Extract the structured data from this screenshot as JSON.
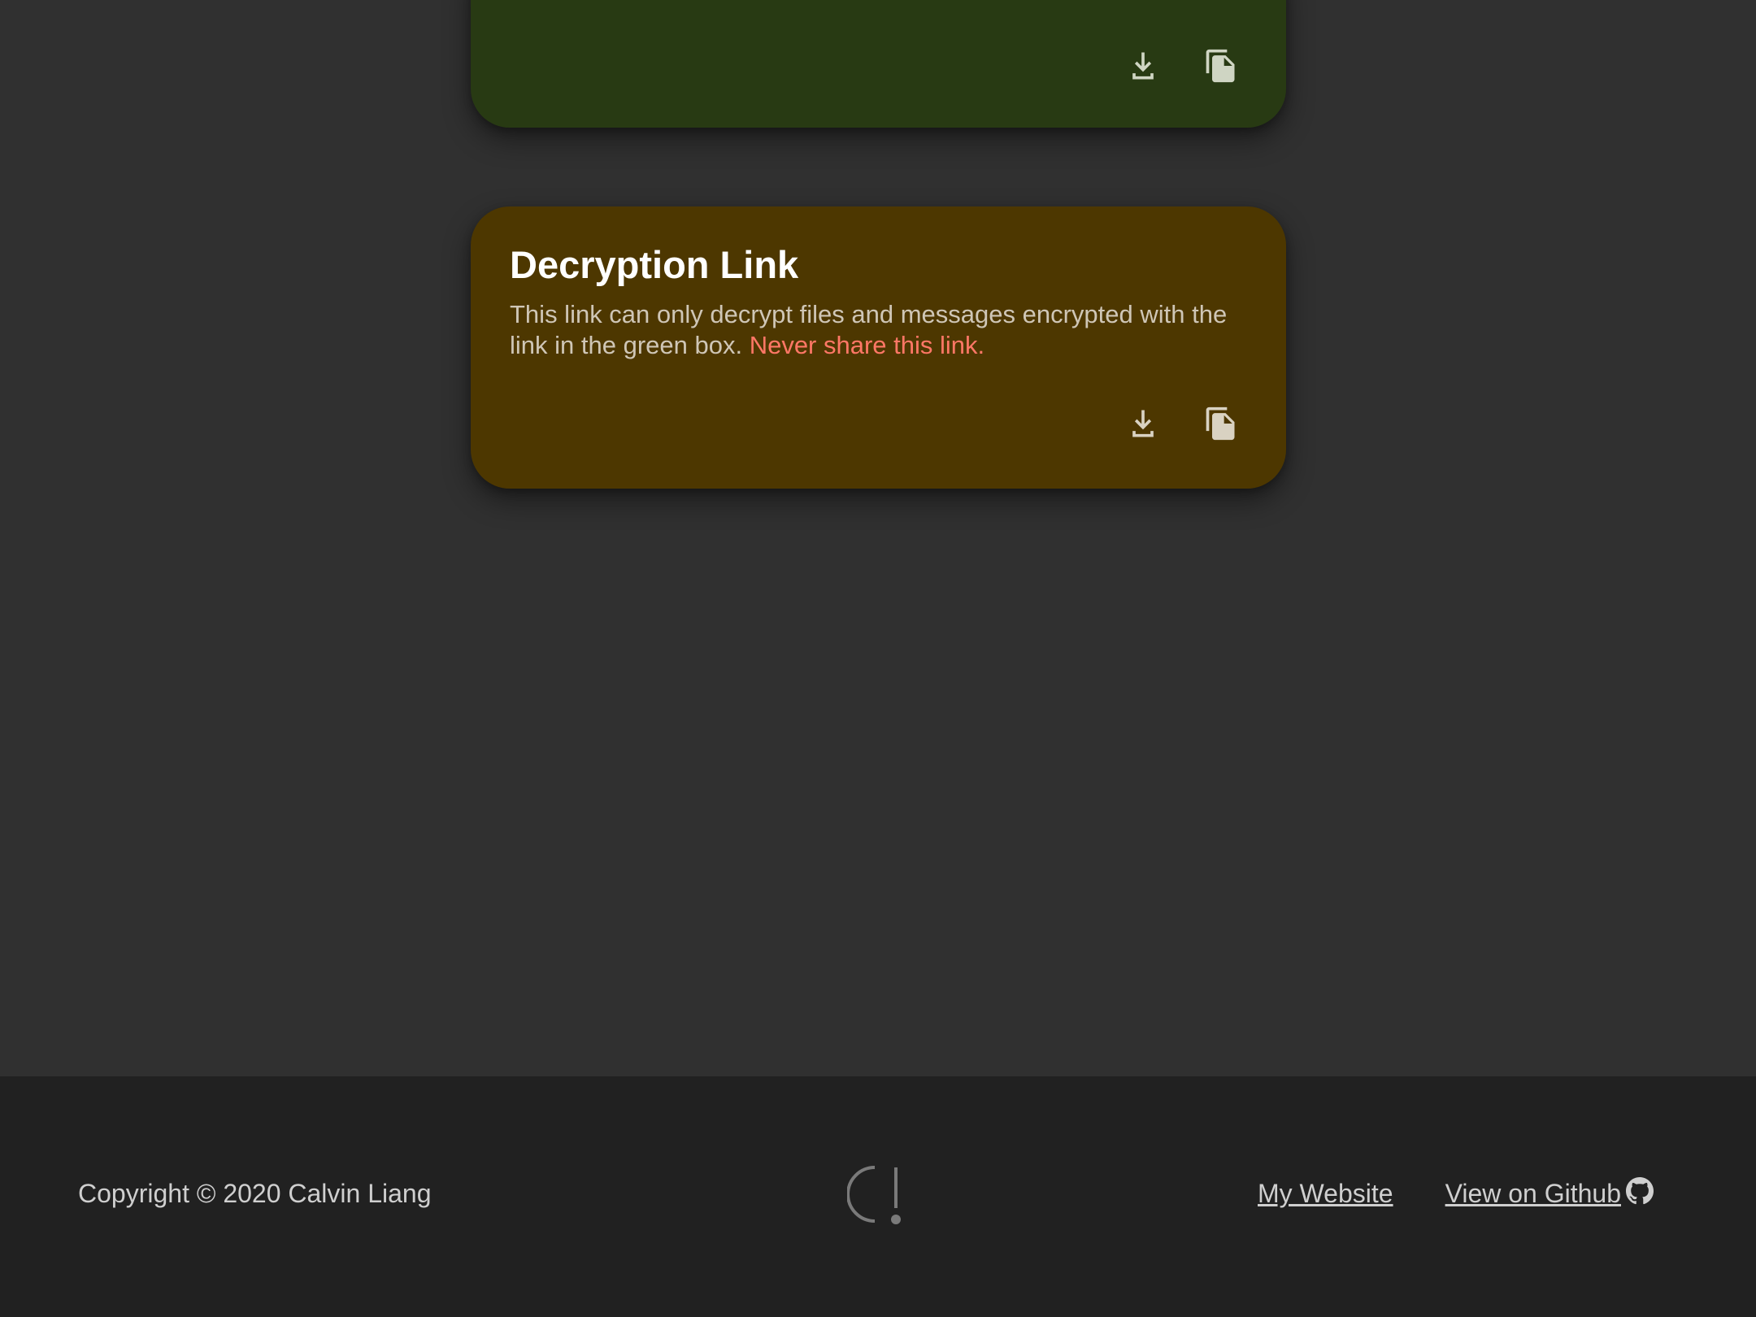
{
  "cards": {
    "green": {
      "actions": {
        "download_icon": "download-icon",
        "copy_icon": "copy-icon"
      },
      "color": "#283a13"
    },
    "decryption": {
      "title": "Decryption Link",
      "description": "This link can only decrypt files and messages encrypted with the link in the green box. ",
      "warning": "Never share this link.",
      "warning_color": "#ff7766",
      "color": "#4d3700",
      "actions": {
        "download_icon": "download-icon",
        "copy_icon": "copy-icon"
      }
    }
  },
  "footer": {
    "copyright": "Copyright © 2020 Calvin Liang",
    "logo_icon": "c-exclamation-logo",
    "links": {
      "website": "My Website",
      "github": "View on Github "
    },
    "github_icon": "github-icon"
  }
}
